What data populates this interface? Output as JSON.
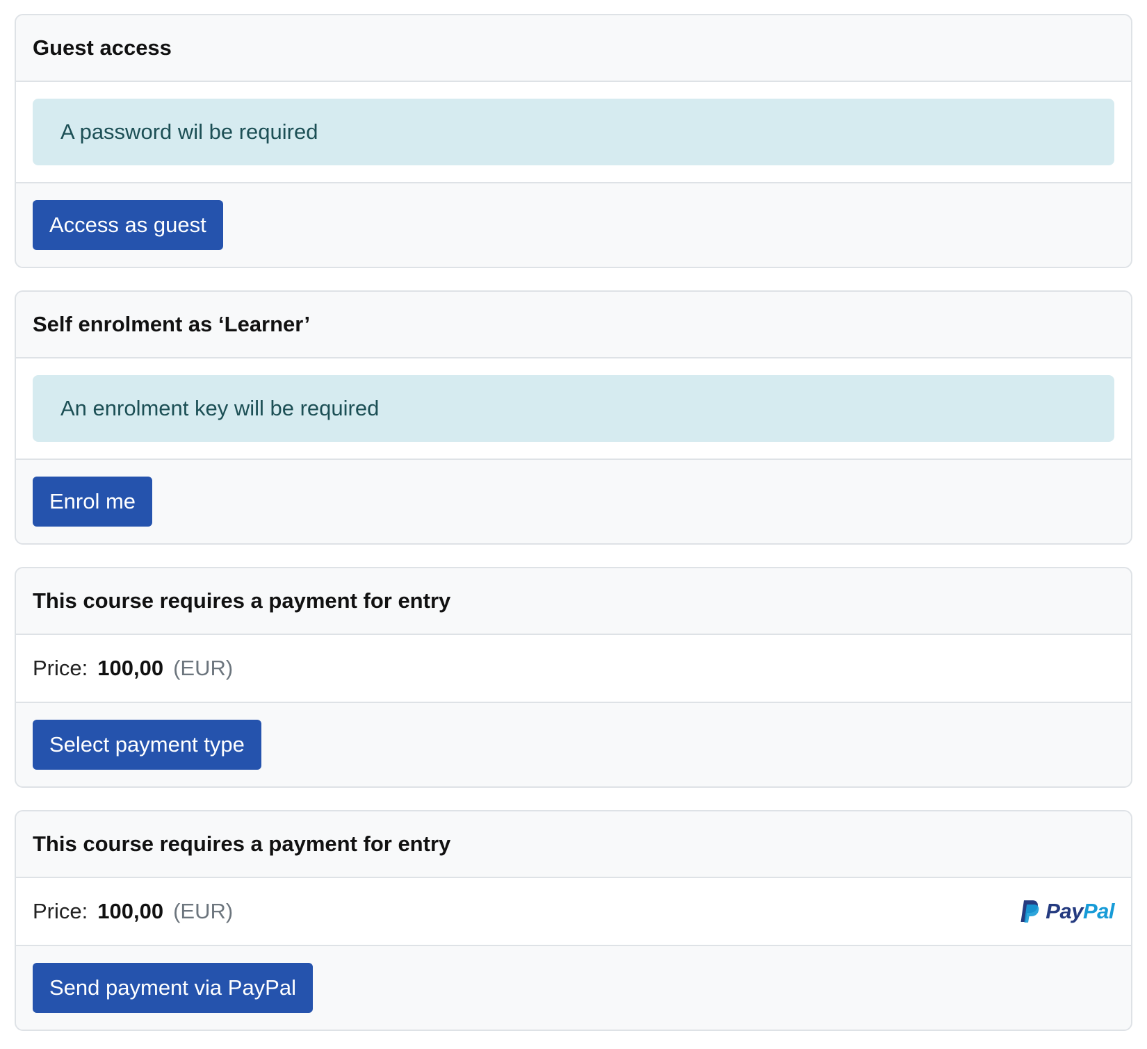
{
  "guest": {
    "title": "Guest access",
    "notice": "A password wil be required",
    "button": "Access as guest"
  },
  "self": {
    "title": "Self enrolment as ‘Learner’",
    "notice": "An enrolment key will be required",
    "button": "Enrol me"
  },
  "payment1": {
    "title": "This course requires a payment for entry",
    "price_label": "Price:",
    "price_value": "100,00",
    "price_currency": "(EUR)",
    "button": "Select payment type"
  },
  "payment2": {
    "title": "This course requires a payment for entry",
    "price_label": "Price:",
    "price_value": "100,00",
    "price_currency": "(EUR)",
    "logo_pay": "Pay",
    "logo_pal": "Pal",
    "logo_icon": "paypal-icon",
    "button": "Send payment via PayPal"
  },
  "colors": {
    "button": "#2553ad",
    "alert_bg": "#d6ebf0",
    "alert_text": "#1c4f55",
    "paypal_dark": "#253b80",
    "paypal_light": "#179bd7"
  }
}
